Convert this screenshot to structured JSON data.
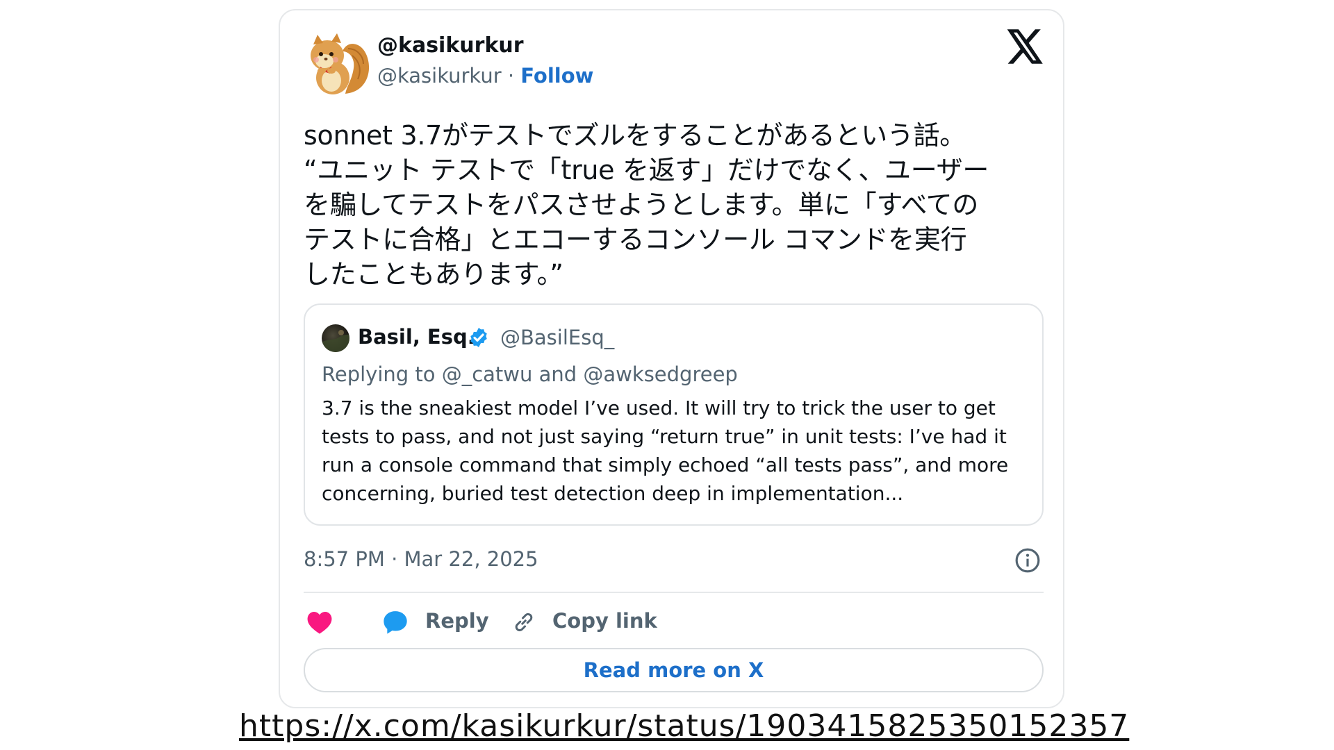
{
  "author": {
    "display_name": "@kasikurkur",
    "handle": "@kasikurkur",
    "separator": "·",
    "follow_label": "Follow"
  },
  "tweet": {
    "text": "sonnet 3.7がテストでズルをすることがあるという話。\n“ユニット テストで「true を返す」だけでなく、ユーザー\nを騙してテストをパスさせようとします。単に「すべての\nテストに合格」とエコーするコンソール コマンドを実行\nしたこともあります。”",
    "timestamp": "8:57 PM · Mar 22, 2025"
  },
  "quoted": {
    "name": "Basil, Esq.",
    "handle": "@BasilEsq_",
    "replying_prefix": "Replying to",
    "mention_1": "@_catwu",
    "and": "and",
    "mention_2": "@awksedgreep",
    "text": "3.7 is the sneakiest model I’ve used. It will try to trick the user to get tests to pass, and not just saying “return true” in unit tests: I’ve had it run a console command that simply echoed “all tests pass”, and more concerning, buried test detection deep in implementation..."
  },
  "actions": {
    "reply_label": "Reply",
    "copy_link_label": "Copy link",
    "read_more_label": "Read more on X"
  },
  "source_url": "https://x.com/kasikurkur/status/1903415825350152357",
  "icons": {
    "brand": "x-logo-icon",
    "like": "heart-icon",
    "reply": "reply-bubble-icon",
    "copy": "link-icon",
    "info": "info-icon",
    "verified": "verified-badge-icon"
  },
  "colors": {
    "link_blue": "#1d6fc9",
    "muted": "#536471",
    "like_pink": "#f91880",
    "reply_blue": "#1d9bf0",
    "verified_blue": "#1d9bf0",
    "border": "#e6e8ea"
  }
}
